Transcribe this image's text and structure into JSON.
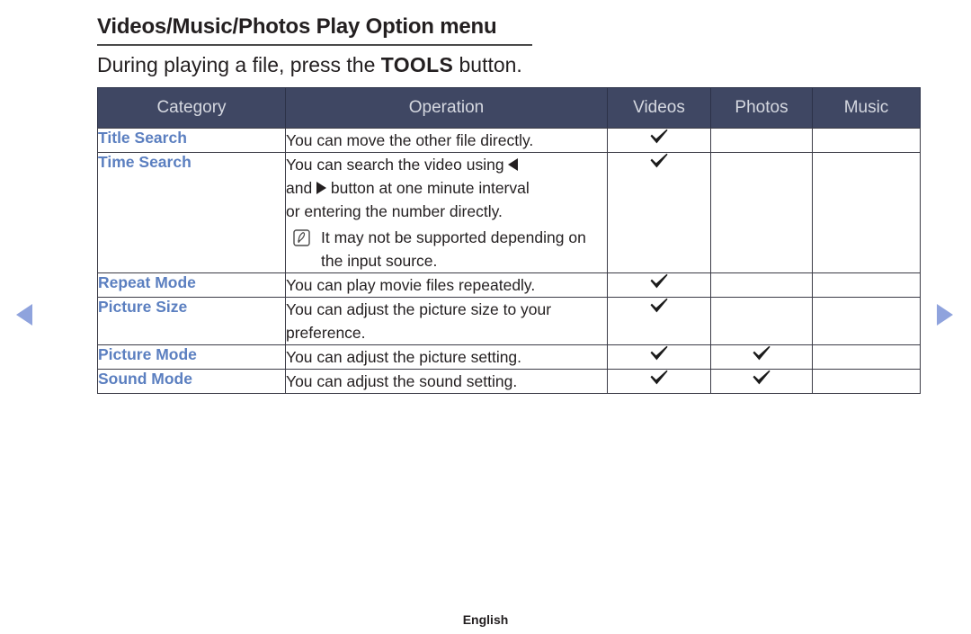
{
  "page": {
    "title": "Videos/Music/Photos Play Option menu",
    "subtitle_before": "During playing a file, press the ",
    "subtitle_keyword": "TOOLS",
    "subtitle_after": " button.",
    "footer_language": "English"
  },
  "navigation": {
    "prev_label": "previous-page",
    "next_label": "next-page",
    "arrow_color": "#8fa3dd"
  },
  "colors": {
    "header_bg": "#3f4763",
    "header_text": "#d5d8e0",
    "category_text": "#5b7fc0",
    "body_text": "#231f20",
    "border": "#3b3b46"
  },
  "table": {
    "columns": [
      "Category",
      "Operation",
      "Videos",
      "Photos",
      "Music"
    ],
    "rows": [
      {
        "category": "Title Search",
        "operation": "You can move the other file directly.",
        "videos": "✓",
        "photos": "",
        "music": ""
      },
      {
        "category": "Time Search",
        "operation_line1_a": "You can search the video using ",
        "operation_line1_b": "",
        "operation_line2_a": "and ",
        "operation_line2_b": " button at one minute interval",
        "operation_line3": "or entering the number directly.",
        "note": "It may not be supported depending on the input source.",
        "note_icon": "note-icon",
        "videos": "✓",
        "photos": "",
        "music": ""
      },
      {
        "category": "Repeat Mode",
        "operation": "You can play movie files repeatedly.",
        "videos": "✓",
        "photos": "",
        "music": ""
      },
      {
        "category": "Picture Size",
        "operation": "You can adjust the picture size to your preference.",
        "videos": "✓",
        "photos": "",
        "music": ""
      },
      {
        "category": "Picture Mode",
        "operation": "You can adjust the picture setting.",
        "videos": "✓",
        "photos": "✓",
        "music": ""
      },
      {
        "category": "Sound Mode",
        "operation": "You can adjust the sound setting.",
        "videos": "✓",
        "photos": "✓",
        "music": ""
      }
    ]
  }
}
